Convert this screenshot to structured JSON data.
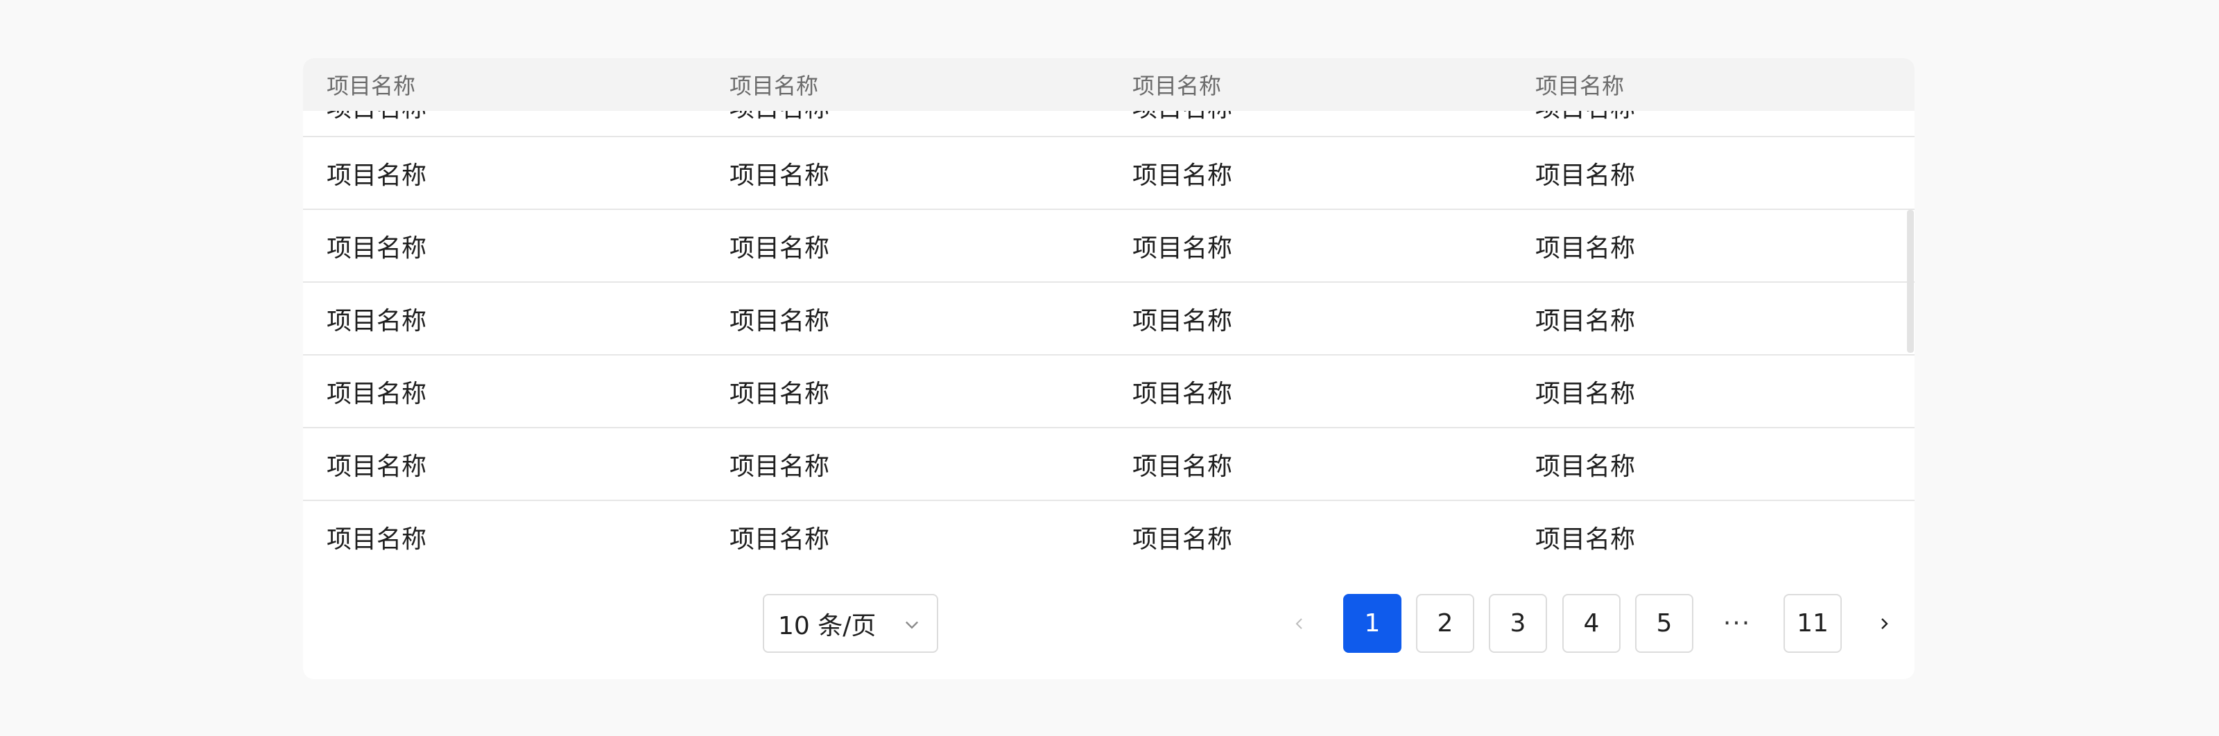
{
  "table": {
    "headers": [
      "项目名称",
      "项目名称",
      "项目名称",
      "项目名称"
    ],
    "rows": [
      [
        "项目名称",
        "项目名称",
        "项目名称",
        "项目名称"
      ],
      [
        "项目名称",
        "项目名称",
        "项目名称",
        "项目名称"
      ],
      [
        "项目名称",
        "项目名称",
        "项目名称",
        "项目名称"
      ],
      [
        "项目名称",
        "项目名称",
        "项目名称",
        "项目名称"
      ],
      [
        "项目名称",
        "项目名称",
        "项目名称",
        "项目名称"
      ],
      [
        "项目名称",
        "项目名称",
        "项目名称",
        "项目名称"
      ],
      [
        "项目名称",
        "项目名称",
        "项目名称",
        "项目名称"
      ]
    ]
  },
  "pagination": {
    "page_size_label": "10 条/页",
    "pages": [
      "1",
      "2",
      "3",
      "4",
      "5",
      "11"
    ],
    "current_page": "1",
    "ellipsis": "···"
  },
  "icons": {
    "prev": "chevron-left-icon",
    "next": "chevron-right-icon",
    "dropdown": "chevron-down-icon"
  },
  "colors": {
    "accent": "#0f5bec",
    "header_bg": "#f3f3f3",
    "page_bg": "#f9f9f9"
  }
}
